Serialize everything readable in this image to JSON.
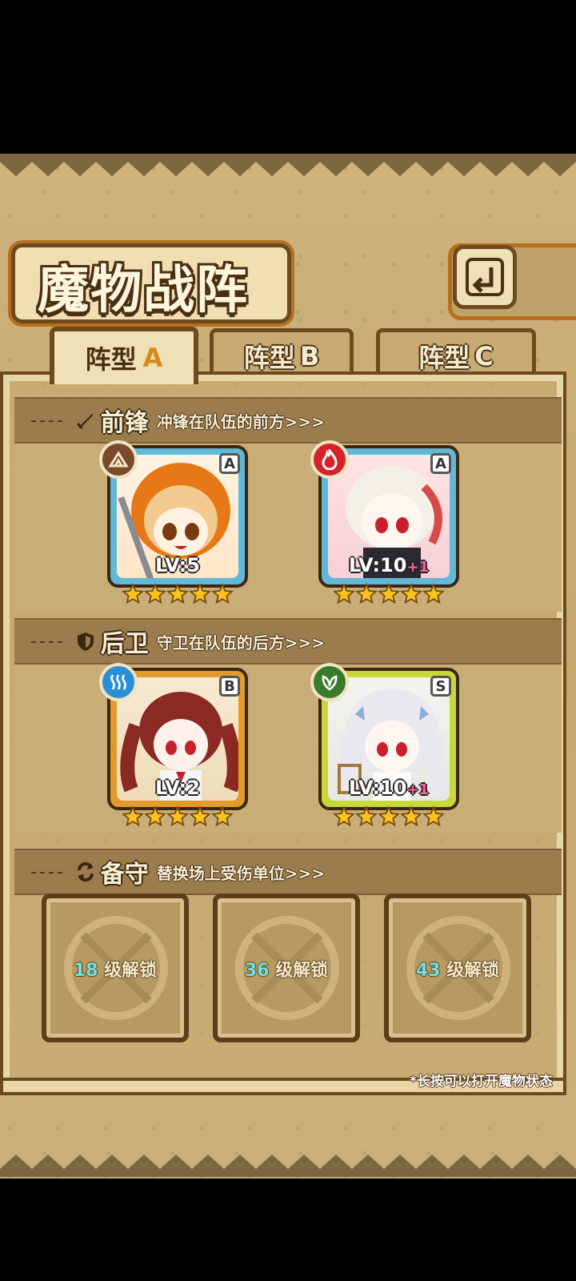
{
  "title": "魔物战阵",
  "tabs": [
    {
      "label": "阵型",
      "letter": "A",
      "active": true
    },
    {
      "label": "阵型",
      "letter": "B",
      "active": false
    },
    {
      "label": "阵型",
      "letter": "C",
      "active": false
    }
  ],
  "sections": {
    "front": {
      "title": "前锋",
      "subtitle": "冲锋在队伍的前方>>>",
      "icon": "sword-icon"
    },
    "rear": {
      "title": "后卫",
      "subtitle": "守卫在队伍的后方>>>",
      "icon": "shield-icon"
    },
    "reserve": {
      "title": "备守",
      "subtitle": "替换场上受伤单位>>>",
      "icon": "swap-icon"
    }
  },
  "monsters": [
    {
      "slot": "front-1",
      "rank": "A",
      "level": "LV:5",
      "plus": "",
      "stars": 5,
      "element": "earth-icon",
      "element_color": "#7a4a2a",
      "frame_color": "#62b8d8",
      "hair_color": "#f2c98f",
      "hood_color": "#e67817"
    },
    {
      "slot": "front-2",
      "rank": "A",
      "level": "LV:10",
      "plus": "+1",
      "stars": 5,
      "element": "fire-icon",
      "element_color": "#d8222a",
      "frame_color": "#62b8d8",
      "hair_color": "#f4f0e8",
      "hood_color": "#7d2b33"
    },
    {
      "slot": "rear-1",
      "rank": "B",
      "level": "LV:2",
      "plus": "",
      "stars": 5,
      "element": "water-icon",
      "element_color": "#2b8fd8",
      "frame_color": "#e49a2a",
      "hair_color": "#8a2a22",
      "hood_color": "#8a2a22"
    },
    {
      "slot": "rear-2",
      "rank": "S",
      "level": "LV:10",
      "plus": "+1",
      "stars": 5,
      "element": "leaf-icon",
      "element_color": "#3a7a2a",
      "frame_color": "#c8d83a",
      "hair_color": "#f2f2f4",
      "hood_color": "#dcdce4"
    }
  ],
  "reserve_slots": [
    {
      "level": "18",
      "label": "级解锁"
    },
    {
      "level": "36",
      "label": "级解锁"
    },
    {
      "level": "43",
      "label": "级解锁"
    }
  ],
  "hint": "*长按可以打开魔物状态",
  "colors": {
    "star": "#f7c51e",
    "parchment": "#cbb07a",
    "frame_dark": "#6d4a1e"
  }
}
